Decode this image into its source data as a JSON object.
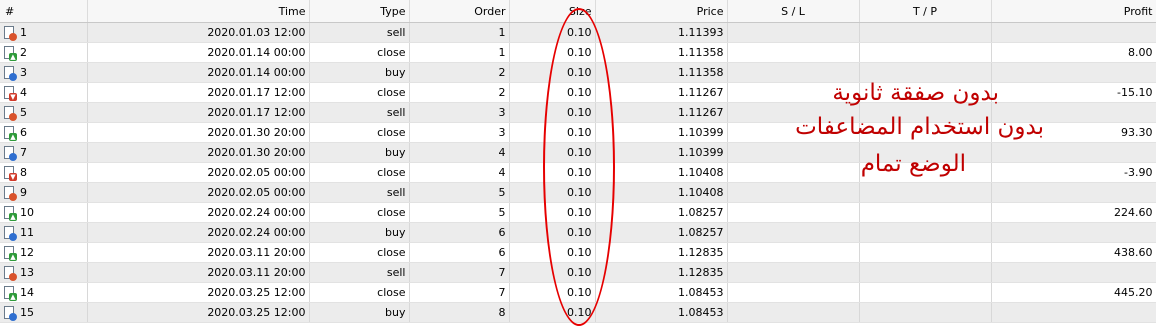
{
  "columns": [
    "#",
    "Time",
    "Type",
    "Order",
    "Size",
    "Price",
    "S / L",
    "T / P",
    "Profit"
  ],
  "rows": [
    {
      "num": "1",
      "time": "2020.01.03 12:00",
      "type": "sell",
      "order": "1",
      "size": "0.10",
      "price": "1.11393",
      "sl": "",
      "tp": "",
      "profit": "",
      "icon": "sell-order-icon"
    },
    {
      "num": "2",
      "time": "2020.01.14 00:00",
      "type": "close",
      "order": "1",
      "size": "0.10",
      "price": "1.11358",
      "sl": "",
      "tp": "",
      "profit": "8.00",
      "icon": "profit-close-icon"
    },
    {
      "num": "3",
      "time": "2020.01.14 00:00",
      "type": "buy",
      "order": "2",
      "size": "0.10",
      "price": "1.11358",
      "sl": "",
      "tp": "",
      "profit": "",
      "icon": "buy-order-icon"
    },
    {
      "num": "4",
      "time": "2020.01.17 12:00",
      "type": "close",
      "order": "2",
      "size": "0.10",
      "price": "1.11267",
      "sl": "",
      "tp": "",
      "profit": "-15.10",
      "icon": "loss-close-icon"
    },
    {
      "num": "5",
      "time": "2020.01.17 12:00",
      "type": "sell",
      "order": "3",
      "size": "0.10",
      "price": "1.11267",
      "sl": "",
      "tp": "",
      "profit": "",
      "icon": "sell-order-icon"
    },
    {
      "num": "6",
      "time": "2020.01.30 20:00",
      "type": "close",
      "order": "3",
      "size": "0.10",
      "price": "1.10399",
      "sl": "",
      "tp": "",
      "profit": "93.30",
      "icon": "profit-close-icon"
    },
    {
      "num": "7",
      "time": "2020.01.30 20:00",
      "type": "buy",
      "order": "4",
      "size": "0.10",
      "price": "1.10399",
      "sl": "",
      "tp": "",
      "profit": "",
      "icon": "buy-order-icon"
    },
    {
      "num": "8",
      "time": "2020.02.05 00:00",
      "type": "close",
      "order": "4",
      "size": "0.10",
      "price": "1.10408",
      "sl": "",
      "tp": "",
      "profit": "-3.90",
      "icon": "loss-close-icon"
    },
    {
      "num": "9",
      "time": "2020.02.05 00:00",
      "type": "sell",
      "order": "5",
      "size": "0.10",
      "price": "1.10408",
      "sl": "",
      "tp": "",
      "profit": "",
      "icon": "sell-order-icon"
    },
    {
      "num": "10",
      "time": "2020.02.24 00:00",
      "type": "close",
      "order": "5",
      "size": "0.10",
      "price": "1.08257",
      "sl": "",
      "tp": "",
      "profit": "224.60",
      "icon": "profit-close-icon"
    },
    {
      "num": "11",
      "time": "2020.02.24 00:00",
      "type": "buy",
      "order": "6",
      "size": "0.10",
      "price": "1.08257",
      "sl": "",
      "tp": "",
      "profit": "",
      "icon": "buy-order-icon"
    },
    {
      "num": "12",
      "time": "2020.03.11 20:00",
      "type": "close",
      "order": "6",
      "size": "0.10",
      "price": "1.12835",
      "sl": "",
      "tp": "",
      "profit": "438.60",
      "icon": "profit-close-icon"
    },
    {
      "num": "13",
      "time": "2020.03.11 20:00",
      "type": "sell",
      "order": "7",
      "size": "0.10",
      "price": "1.12835",
      "sl": "",
      "tp": "",
      "profit": "",
      "icon": "sell-order-icon"
    },
    {
      "num": "14",
      "time": "2020.03.25 12:00",
      "type": "close",
      "order": "7",
      "size": "0.10",
      "price": "1.08453",
      "sl": "",
      "tp": "",
      "profit": "445.20",
      "icon": "profit-close-icon"
    },
    {
      "num": "15",
      "time": "2020.03.25 12:00",
      "type": "buy",
      "order": "8",
      "size": "0.10",
      "price": "1.08453",
      "sl": "",
      "tp": "",
      "profit": "",
      "icon": "buy-order-icon"
    }
  ],
  "annotation": {
    "line1": "بدون صفقة ثانوية",
    "line2": "بدون استخدام المضاعفات",
    "line3": "الوضع تمام",
    "color": "#c00000"
  },
  "highlight_color": "#e60000"
}
